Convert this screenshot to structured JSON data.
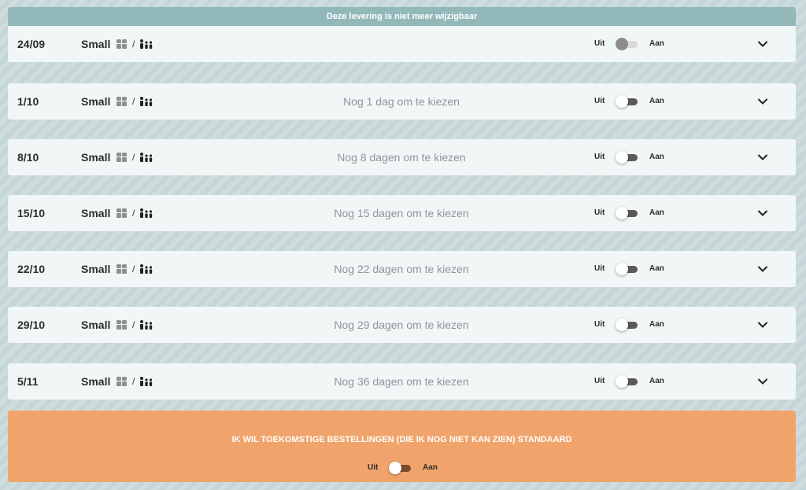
{
  "banner": {
    "text": "Deze levering is niet meer wijzigbaar"
  },
  "toggle_labels": {
    "off": "Uit",
    "on": "Aan"
  },
  "slash": "/",
  "icons": {
    "small_box": "two-persons-icon",
    "large_box": "family-icon",
    "expand": "chevron-down-icon"
  },
  "deliveries": [
    {
      "date": "24/09",
      "size": "Small",
      "countdown": "",
      "locked": true
    },
    {
      "date": "1/10",
      "size": "Small",
      "countdown": "Nog 1 dag om te kiezen",
      "locked": false
    },
    {
      "date": "8/10",
      "size": "Small",
      "countdown": "Nog 8 dagen om te kiezen",
      "locked": false
    },
    {
      "date": "15/10",
      "size": "Small",
      "countdown": "Nog 15 dagen om te kiezen",
      "locked": false
    },
    {
      "date": "22/10",
      "size": "Small",
      "countdown": "Nog 22 dagen om te kiezen",
      "locked": false
    },
    {
      "date": "29/10",
      "size": "Small",
      "countdown": "Nog 29 dagen om te kiezen",
      "locked": false
    },
    {
      "date": "5/11",
      "size": "Small",
      "countdown": "Nog 36 dagen om te kiezen",
      "locked": false
    }
  ],
  "future": {
    "text": "IK WIL TOEKOMSTIGE BESTELLINGEN (DIE IK NOG NIET KAN ZIEN) STANDAARD"
  },
  "colors": {
    "banner": "#93b8ba",
    "accent_orange": "#f0a46b",
    "row_bg": "#f1f6f7",
    "page_bg": "#c5d6d8"
  }
}
